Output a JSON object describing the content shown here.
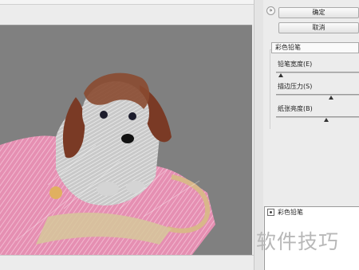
{
  "dialog": {
    "ok_label": "确定",
    "cancel_label": "取消",
    "collapse_glyph": "»"
  },
  "filter": {
    "selected": "彩色铅笔"
  },
  "params": [
    {
      "label": "铅笔宽度(E)",
      "level": 0.06
    },
    {
      "label": "描边压力(S)",
      "level": 0.67
    },
    {
      "label": "纸张亮度(B)",
      "level": 0.61
    }
  ],
  "layers": [
    {
      "label": "彩色铅笔"
    }
  ],
  "watermark": "软件技巧",
  "colors": {
    "canvas_bg": "#808080",
    "bag_pink": "#e58fb2",
    "dog_brown": "#7a3a25",
    "dog_white": "#d8d8d8"
  },
  "icons": {
    "collapse": "double-chevron-icon",
    "visibility": "eye-icon"
  }
}
